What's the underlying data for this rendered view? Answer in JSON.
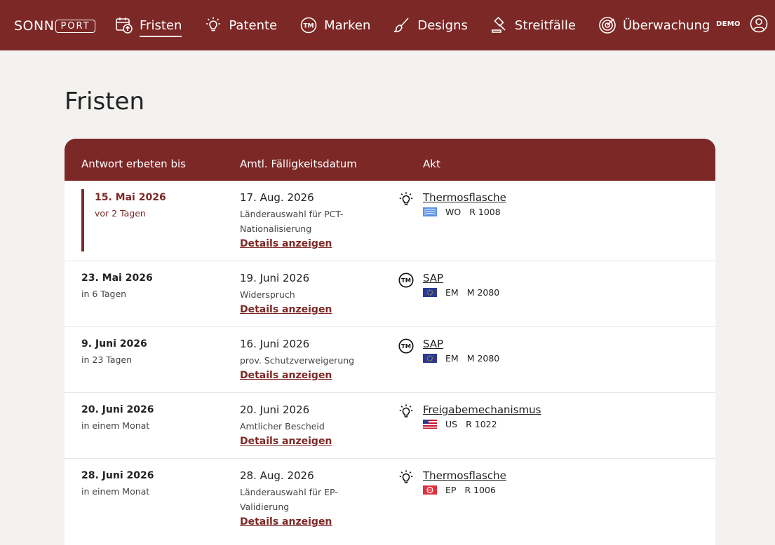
{
  "header": {
    "logo": {
      "left": "SONN",
      "right": "PORT"
    },
    "nav": [
      {
        "label": "Fristen",
        "icon": "calendar-icon",
        "active": true
      },
      {
        "label": "Patente",
        "icon": "lightbulb-icon"
      },
      {
        "label": "Marken",
        "icon": "trademark-icon"
      },
      {
        "label": "Designs",
        "icon": "brush-icon"
      },
      {
        "label": "Streitfälle",
        "icon": "gavel-icon"
      },
      {
        "label": "Überwachung",
        "icon": "radar-icon"
      }
    ],
    "demo_label": "DEMO",
    "user_icon": "user-icon"
  },
  "page": {
    "title": "Fristen"
  },
  "table": {
    "headers": [
      "Antwort erbeten bis",
      "Amtl. Fälligkeitsdatum",
      "Akt"
    ],
    "details_label": "Details anzeigen",
    "rows": [
      {
        "reply_date": "15. Mai 2026",
        "relative": "vor 2 Tagen",
        "urgent": true,
        "official_date": "17. Aug. 2026",
        "action": "Länderauswahl für PCT-Nationalisierung",
        "type_icon": "lightbulb-icon",
        "title": "Thermosflasche",
        "office": "WO",
        "ref": "R 1008",
        "flag": "wipo-flag"
      },
      {
        "reply_date": "23. Mai 2026",
        "relative": "in 6 Tagen",
        "urgent": false,
        "official_date": "19. Juni 2026",
        "action": "Widerspruch",
        "type_icon": "trademark-icon",
        "title": "SAP",
        "office": "EM",
        "ref": "M 2080",
        "flag": "eu-flag"
      },
      {
        "reply_date": "9. Juni 2026",
        "relative": "in 23 Tagen",
        "urgent": false,
        "official_date": "16. Juni 2026",
        "action": "prov. Schutzverweigerung",
        "type_icon": "trademark-icon",
        "title": "SAP",
        "office": "EM",
        "ref": "M 2080",
        "flag": "eu-flag"
      },
      {
        "reply_date": "20. Juni 2026",
        "relative": "in einem Monat",
        "urgent": false,
        "official_date": "20. Juni 2026",
        "action": "Amtlicher Bescheid",
        "type_icon": "lightbulb-icon",
        "title": "Freigabemechanismus",
        "office": "US",
        "ref": "R 1022",
        "flag": "us-flag"
      },
      {
        "reply_date": "28. Juni 2026",
        "relative": "in einem Monat",
        "urgent": false,
        "official_date": "28. Aug. 2026",
        "action": "Länderauswahl für EP-Validierung",
        "type_icon": "lightbulb-icon",
        "title": "Thermosflasche",
        "office": "EP",
        "ref": "R 1006",
        "flag": "epo-flag"
      }
    ]
  },
  "colors": {
    "brand": "#7c2826",
    "background": "#f3f2f0"
  }
}
